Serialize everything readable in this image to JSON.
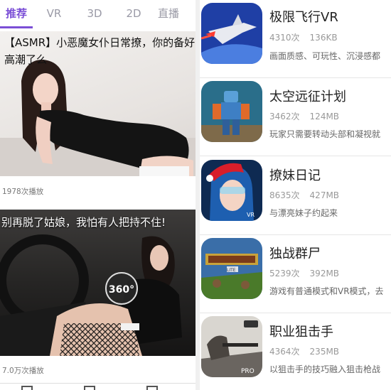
{
  "tabs": [
    {
      "label": "推荐",
      "active": true
    },
    {
      "label": "VR",
      "active": false
    },
    {
      "label": "3D",
      "active": false
    },
    {
      "label": "2D",
      "active": false
    },
    {
      "label": "直播",
      "active": false
    }
  ],
  "videos": [
    {
      "title": "【ASMR】小恶魔女仆日常撩，你的备好高潮了么",
      "plays": "1978次播放"
    },
    {
      "title": "别再脱了姑娘，我怕有人把持不住!",
      "plays": "7.0万次播放",
      "badge": "360°"
    }
  ],
  "apps": [
    {
      "name": "极限飞行VR",
      "downloads": "4310次",
      "size": "136KB",
      "desc": "画面质感、可玩性、沉浸感都"
    },
    {
      "name": "太空远征计划",
      "downloads": "3462次",
      "size": "124MB",
      "desc": "玩家只需要转动头部和凝视就"
    },
    {
      "name": "撩妹日记",
      "downloads": "8635次",
      "size": "427MB",
      "desc": "与漂亮妹子约起来"
    },
    {
      "name": "独战群尸",
      "downloads": "5239次",
      "size": "392MB",
      "desc": "游戏有普通模式和VR模式，去"
    },
    {
      "name": "职业狙击手",
      "downloads": "4364次",
      "size": "235MB",
      "desc": "以狙击手的技巧融入狙击枪战"
    }
  ],
  "icon_text": {
    "lite": "LITE",
    "pro": "PRO",
    "vr": "VR"
  },
  "colors": {
    "accent": "#7b4fd6"
  }
}
